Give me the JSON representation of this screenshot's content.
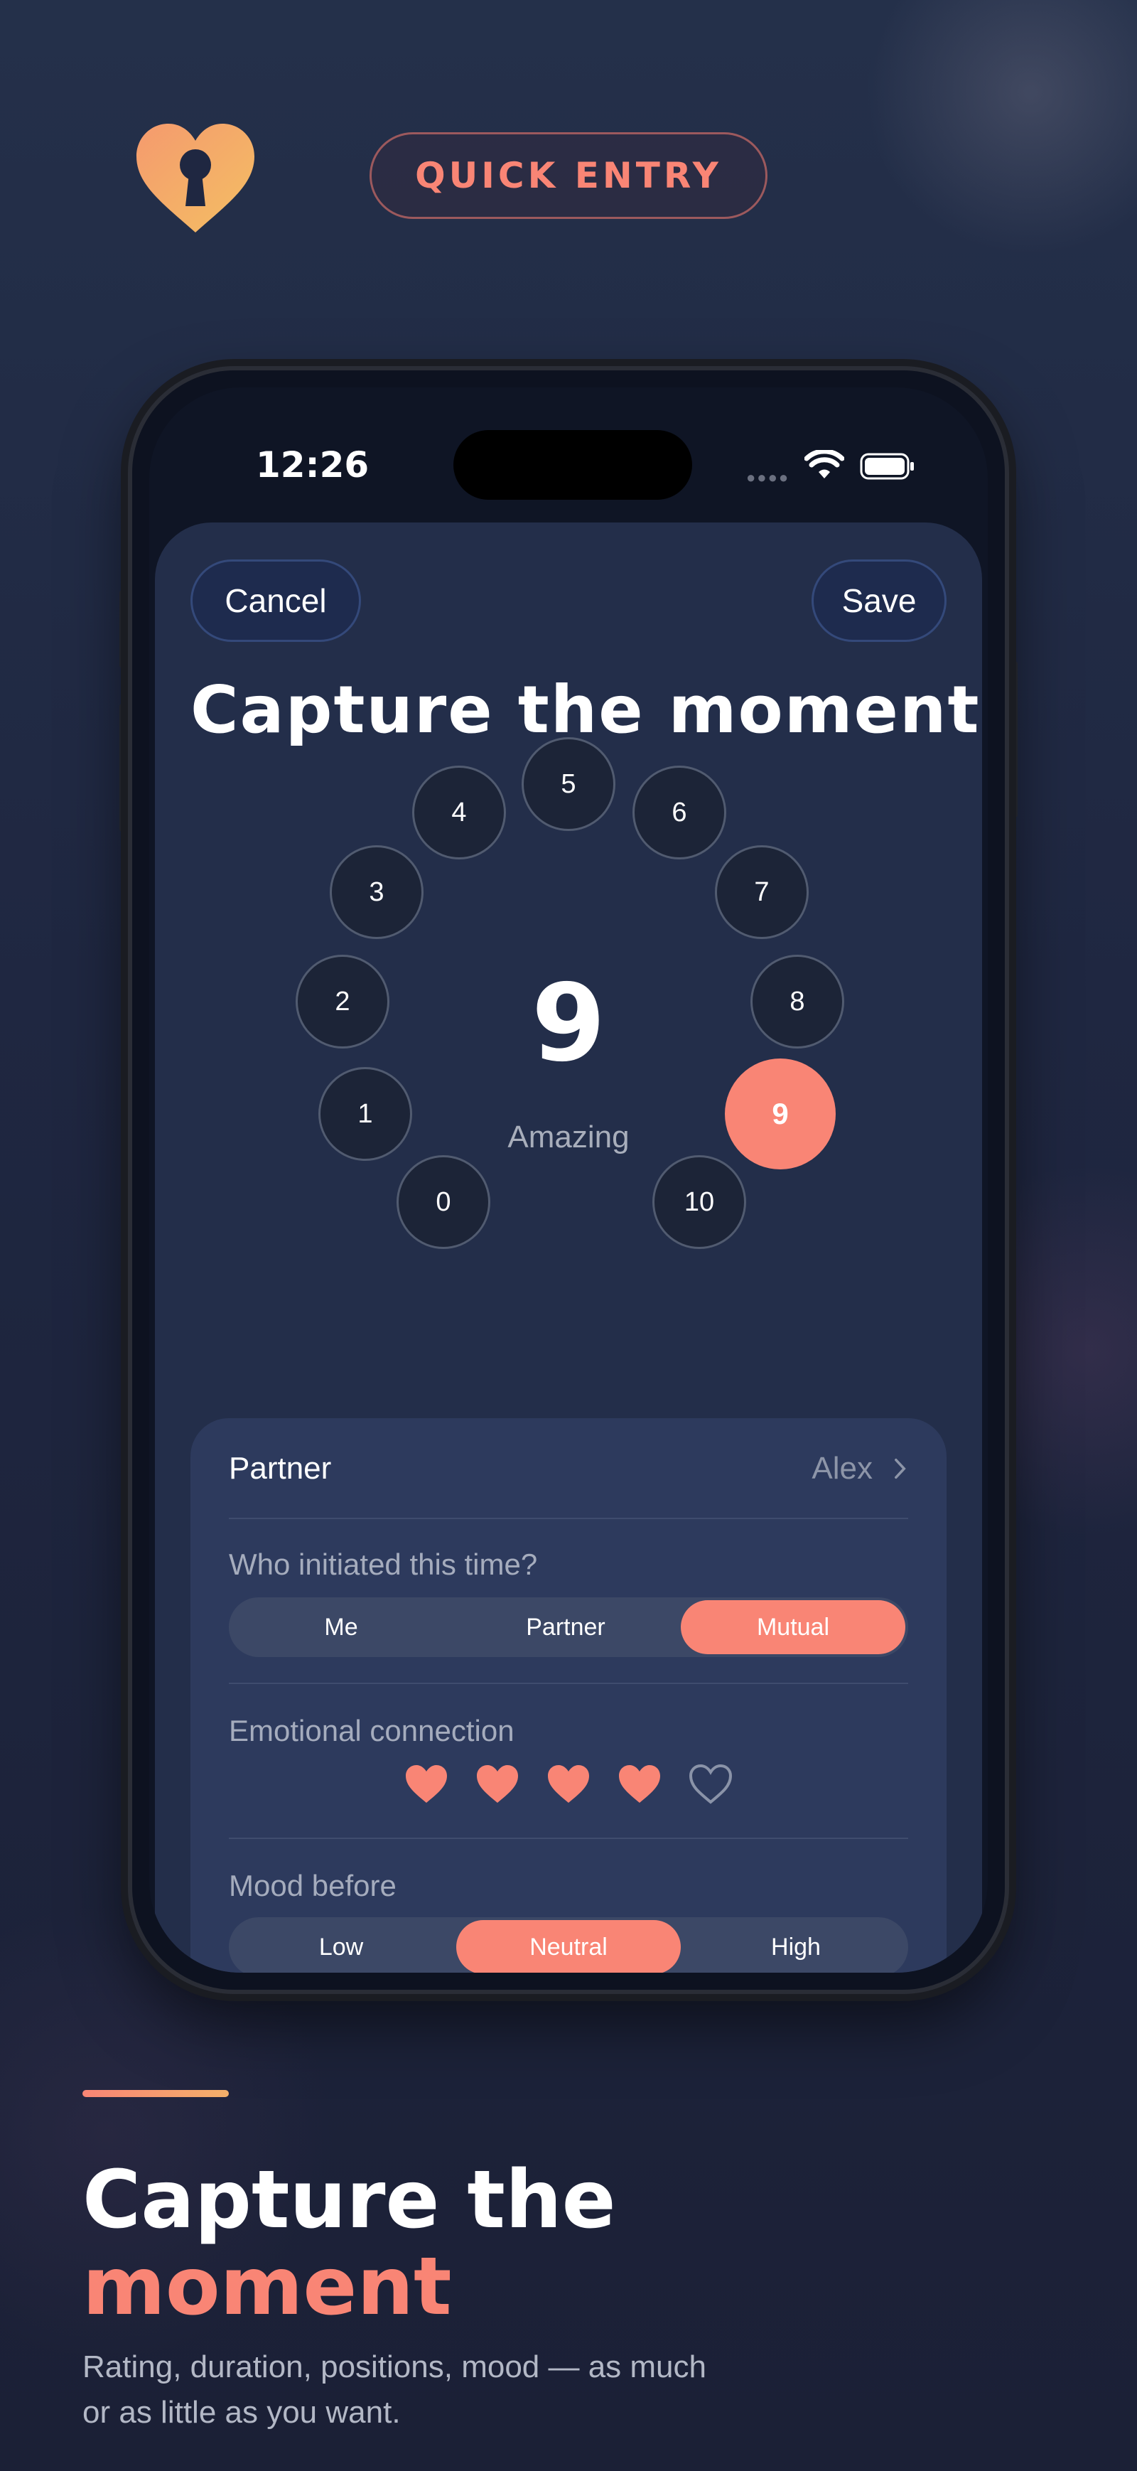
{
  "header": {
    "badge_label": "QUICK ENTRY"
  },
  "status_bar": {
    "time": "12:26"
  },
  "sheet": {
    "cancel_label": "Cancel",
    "save_label": "Save",
    "title": "Capture the moment",
    "rating": {
      "value": "9",
      "descriptor": "Amazing",
      "selected": 9,
      "options": [
        "0",
        "1",
        "2",
        "3",
        "4",
        "5",
        "6",
        "7",
        "8",
        "9",
        "10"
      ]
    }
  },
  "details": {
    "partner_label": "Partner",
    "partner_value": "Alex",
    "initiator_label": "Who initiated this time?",
    "initiator_options": [
      "Me",
      "Partner",
      "Mutual"
    ],
    "initiator_selected": "Mutual",
    "connection_label": "Emotional connection",
    "connection_rating": 4,
    "connection_max": 5,
    "mood_label": "Mood before",
    "mood_options": [
      "Low",
      "Neutral",
      "High"
    ],
    "mood_selected": "Neutral"
  },
  "promo": {
    "headline_line1": "Capture the",
    "headline_line2": "moment",
    "subtitle": "Rating, duration, positions, mood — as much or as little as you want."
  },
  "colors": {
    "accent": "#f98575",
    "sheet": "#232e4a",
    "card": "#2d3a5d"
  },
  "icons": [
    "heart-keyhole-logo-icon",
    "wifi-icon",
    "battery-icon",
    "chevron-right-icon",
    "heart-filled-icon",
    "heart-outline-icon"
  ]
}
